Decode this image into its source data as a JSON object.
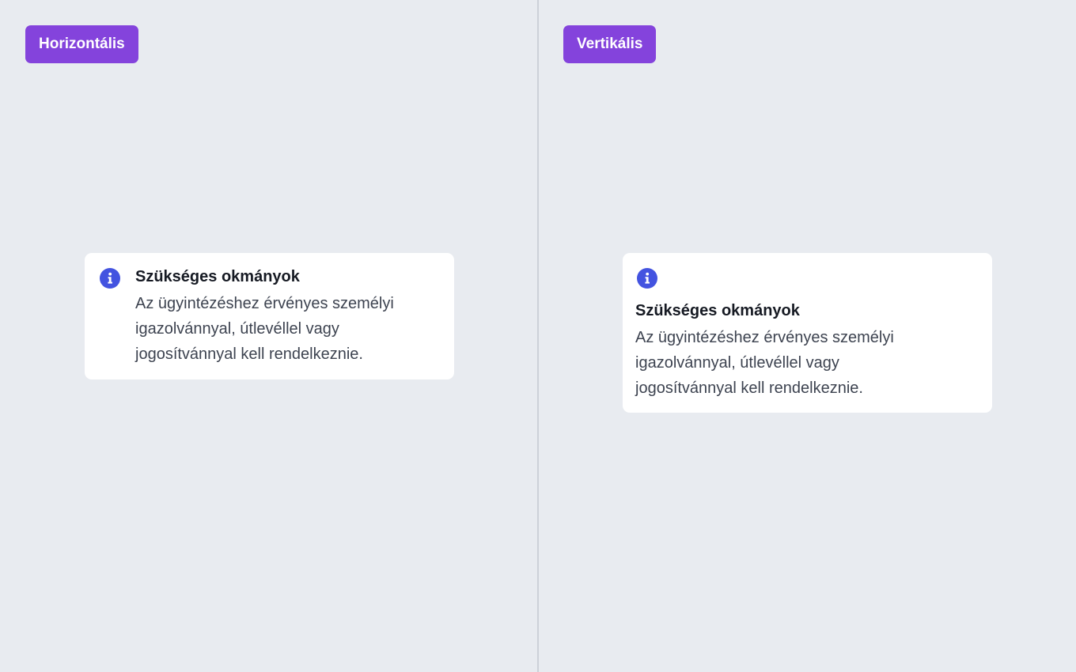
{
  "left_panel": {
    "tag_label": "Horizontális",
    "card": {
      "icon": "info-icon",
      "title": "Szükséges okmányok",
      "body": "Az ügyintézéshez érvényes személyi igazolvánnyal, útlevéllel vagy jogosítvánnyal kell rendelkeznie."
    }
  },
  "right_panel": {
    "tag_label": "Vertikális",
    "card": {
      "icon": "info-icon",
      "title": "Szükséges okmányok",
      "body": "Az ügyintézéshez érvényes személyi igazolvánnyal, útlevéllel vagy jogosítvánnyal kell rendelkeznie."
    }
  },
  "colors": {
    "background": "#e8ebf0",
    "tag": "#8443dc",
    "icon": "#4353e0",
    "divider": "#cdd1d8"
  }
}
